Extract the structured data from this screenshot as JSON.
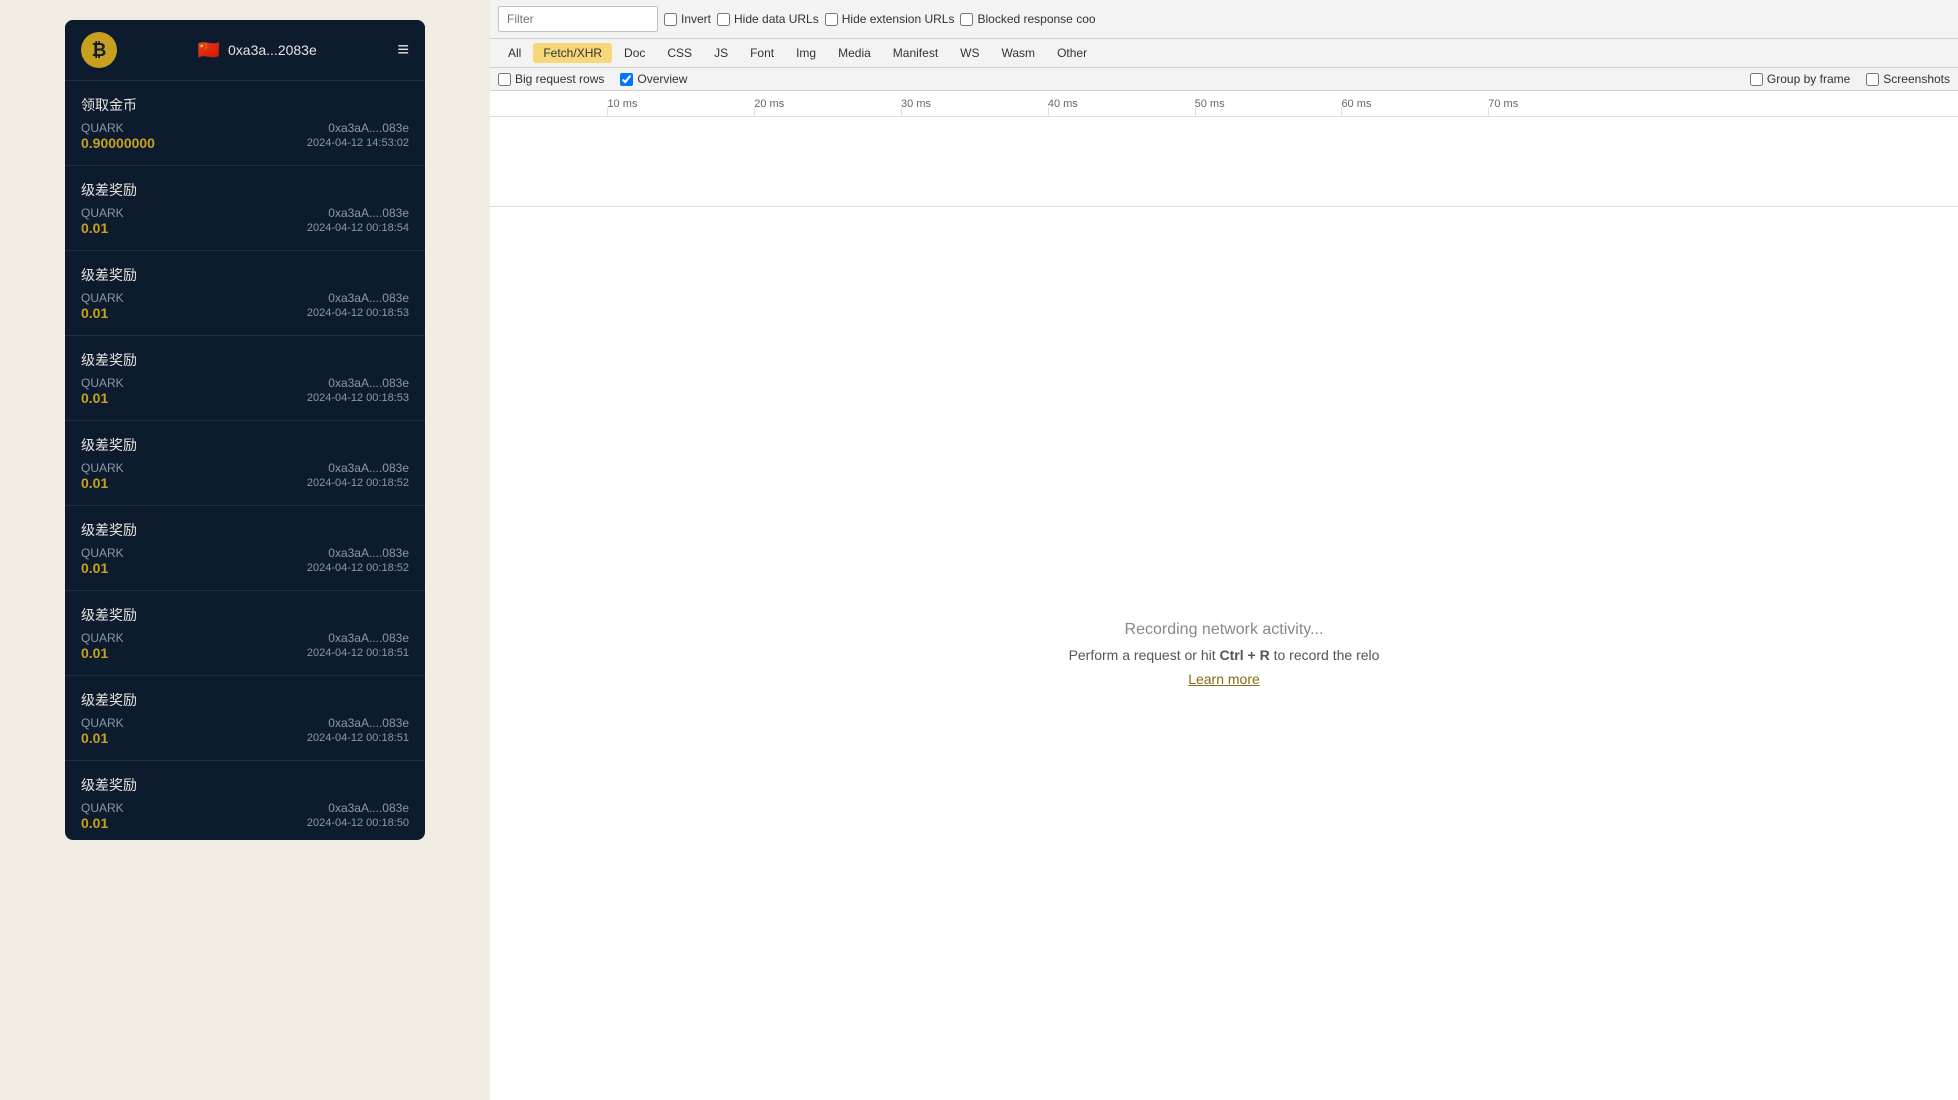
{
  "app": {
    "logo_symbol": "₿",
    "flag": "🇨🇳",
    "address": "0xa3a...2083e",
    "menu_label": "≡"
  },
  "transactions": [
    {
      "title": "领取金币",
      "token": "QUARK",
      "address": "0xa3aA....083e",
      "amount": "0.90000000",
      "date": "2024-04-12 14:53:02"
    },
    {
      "title": "级差奖励",
      "token": "QUARK",
      "address": "0xa3aA....083e",
      "amount": "0.01",
      "date": "2024-04-12 00:18:54"
    },
    {
      "title": "级差奖励",
      "token": "QUARK",
      "address": "0xa3aA....083e",
      "amount": "0.01",
      "date": "2024-04-12 00:18:53"
    },
    {
      "title": "级差奖励",
      "token": "QUARK",
      "address": "0xa3aA....083e",
      "amount": "0.01",
      "date": "2024-04-12 00:18:53"
    },
    {
      "title": "级差奖励",
      "token": "QUARK",
      "address": "0xa3aA....083e",
      "amount": "0.01",
      "date": "2024-04-12 00:18:52"
    },
    {
      "title": "级差奖励",
      "token": "QUARK",
      "address": "0xa3aA....083e",
      "amount": "0.01",
      "date": "2024-04-12 00:18:52"
    },
    {
      "title": "级差奖励",
      "token": "QUARK",
      "address": "0xa3aA....083e",
      "amount": "0.01",
      "date": "2024-04-12 00:18:51"
    },
    {
      "title": "级差奖励",
      "token": "QUARK",
      "address": "0xa3aA....083e",
      "amount": "0.01",
      "date": "2024-04-12 00:18:51"
    },
    {
      "title": "级差奖励",
      "token": "QUARK",
      "address": "0xa3aA....083e",
      "amount": "0.01",
      "date": "2024-04-12 00:18:50"
    }
  ],
  "devtools": {
    "filter_placeholder": "Filter",
    "toolbar": {
      "invert_label": "Invert",
      "hide_data_urls_label": "Hide data URLs",
      "hide_extension_urls_label": "Hide extension URLs",
      "blocked_response_label": "Blocked response coo"
    },
    "filter_tabs": [
      {
        "label": "All",
        "active": false
      },
      {
        "label": "Fetch/XHR",
        "active": true
      },
      {
        "label": "Doc",
        "active": false
      },
      {
        "label": "CSS",
        "active": false
      },
      {
        "label": "JS",
        "active": false
      },
      {
        "label": "Font",
        "active": false
      },
      {
        "label": "Img",
        "active": false
      },
      {
        "label": "Media",
        "active": false
      },
      {
        "label": "Manifest",
        "active": false
      },
      {
        "label": "WS",
        "active": false
      },
      {
        "label": "Wasm",
        "active": false
      },
      {
        "label": "Other",
        "active": false
      }
    ],
    "options": {
      "big_request_rows_label": "Big request rows",
      "overview_label": "Overview",
      "group_by_frame_label": "Group by frame",
      "screenshots_label": "Screenshots"
    },
    "timeline_markers": [
      {
        "label": "10 ms",
        "left_pct": 8
      },
      {
        "label": "20 ms",
        "left_pct": 18
      },
      {
        "label": "30 ms",
        "left_pct": 28
      },
      {
        "label": "40 ms",
        "left_pct": 38
      },
      {
        "label": "50 ms",
        "left_pct": 48
      },
      {
        "label": "60 ms",
        "left_pct": 58
      },
      {
        "label": "70 ms",
        "left_pct": 68
      }
    ],
    "empty_state": {
      "recording_text": "Recording network activity...",
      "perform_text_before": "Perform a request or hit ",
      "shortcut": "Ctrl + R",
      "perform_text_after": " to record the relo",
      "learn_more": "Learn more"
    }
  }
}
